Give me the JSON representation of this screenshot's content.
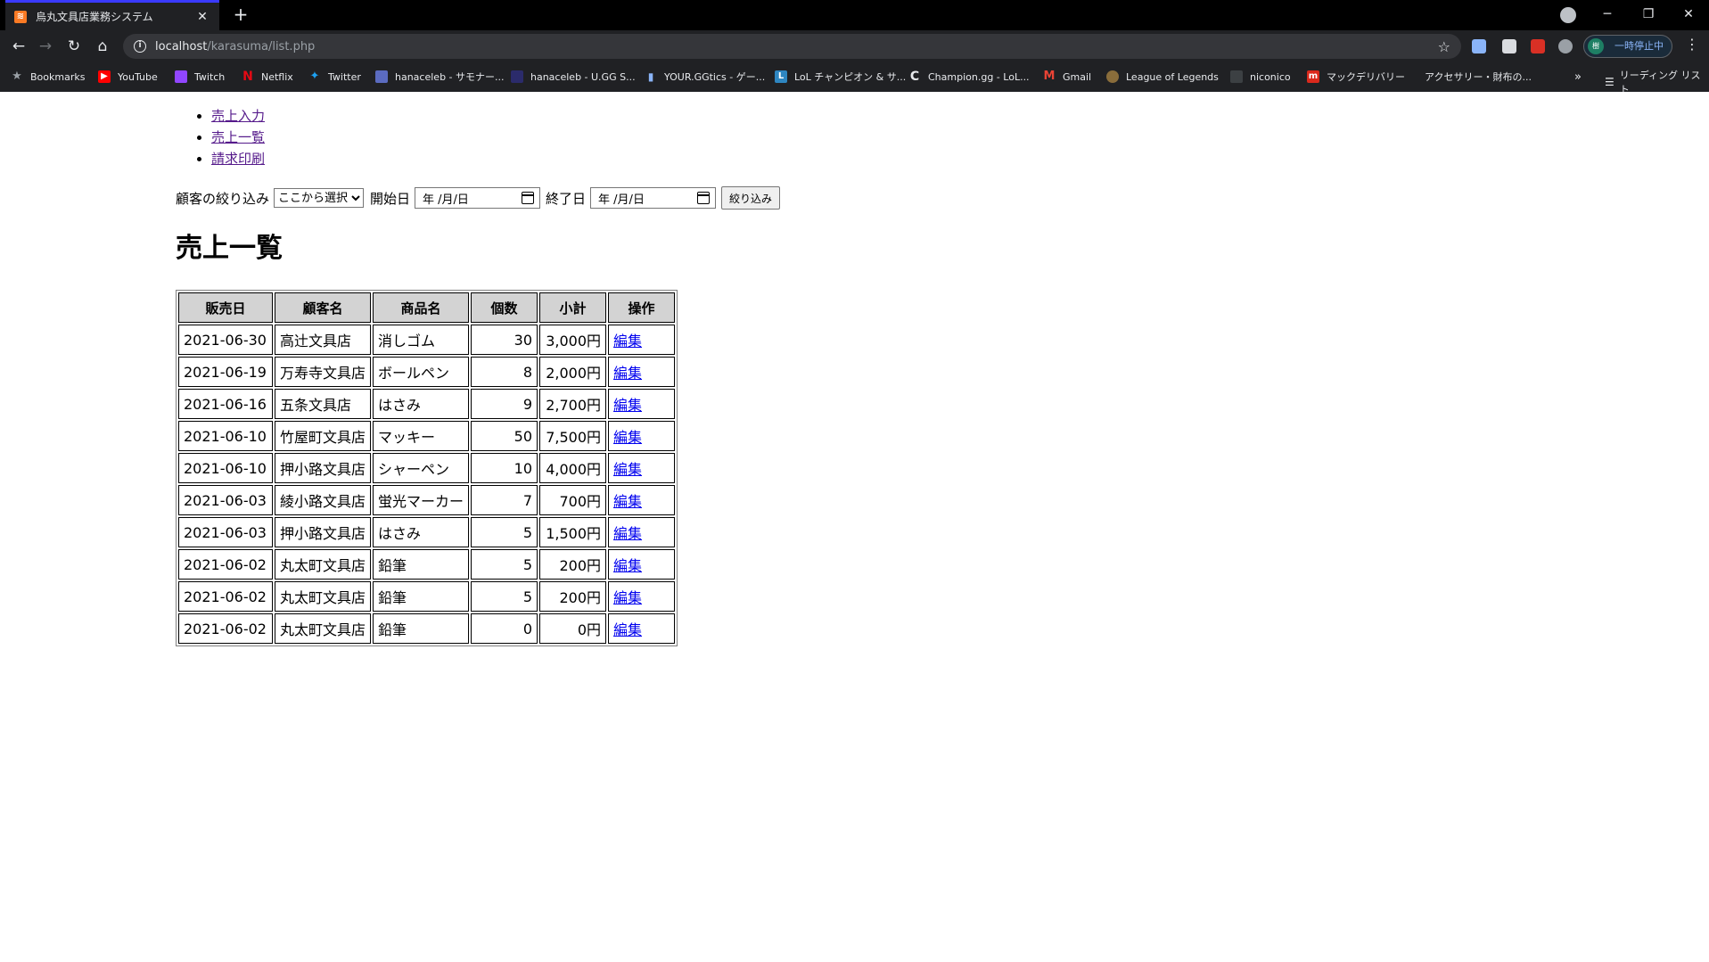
{
  "browser": {
    "tab_title": "烏丸文具店業務システム",
    "url_host": "localhost",
    "url_path": "/karasuma/list.php",
    "pause_label": "一時停止中",
    "reading_list": "リーディング リスト",
    "bookmarks": [
      {
        "label": "Bookmarks",
        "icon": "star-icon"
      },
      {
        "label": "YouTube",
        "icon": "youtube-icon"
      },
      {
        "label": "Twitch",
        "icon": "twitch-icon"
      },
      {
        "label": "Netflix",
        "icon": "netflix-icon"
      },
      {
        "label": "Twitter",
        "icon": "twitter-icon"
      },
      {
        "label": "hanaceleb - サモナー...",
        "icon": "site-icon"
      },
      {
        "label": "hanaceleb - U.GG S...",
        "icon": "ugg-icon"
      },
      {
        "label": "YOUR.GGtics - ゲー...",
        "icon": "chart-icon"
      },
      {
        "label": "LoL チャンピオン & サ...",
        "icon": "lol-icon"
      },
      {
        "label": "Champion.gg - LoL...",
        "icon": "champion-icon"
      },
      {
        "label": "Gmail",
        "icon": "gmail-icon"
      },
      {
        "label": "League of Legends",
        "icon": "league-icon"
      },
      {
        "label": "niconico",
        "icon": "niconico-icon"
      },
      {
        "label": "マックデリバリー",
        "icon": "mcdonalds-icon"
      },
      {
        "label": "アクセサリー・財布の...",
        "icon": "none"
      }
    ]
  },
  "nav": {
    "items": [
      "売上入力",
      "売上一覧",
      "請求印刷"
    ]
  },
  "filter": {
    "customer_label": "顧客の絞り込み",
    "customer_selected": "ここから選択",
    "start_label": "開始日",
    "start_value": "年 /月/日",
    "end_label": "終了日",
    "end_value": "年 /月/日",
    "button_label": "絞り込み"
  },
  "page_title": "売上一覧",
  "table": {
    "headers": [
      "販売日",
      "顧客名",
      "商品名",
      "個数",
      "小計",
      "操作"
    ],
    "rows": [
      {
        "date": "2021-06-30",
        "customer": "高辻文具店",
        "product": "消しゴム",
        "qty": "30",
        "subtotal": "3,000円",
        "action": "編集"
      },
      {
        "date": "2021-06-19",
        "customer": "万寿寺文具店",
        "product": "ボールペン",
        "qty": "8",
        "subtotal": "2,000円",
        "action": "編集"
      },
      {
        "date": "2021-06-16",
        "customer": "五条文具店",
        "product": "はさみ",
        "qty": "9",
        "subtotal": "2,700円",
        "action": "編集"
      },
      {
        "date": "2021-06-10",
        "customer": "竹屋町文具店",
        "product": "マッキー",
        "qty": "50",
        "subtotal": "7,500円",
        "action": "編集"
      },
      {
        "date": "2021-06-10",
        "customer": "押小路文具店",
        "product": "シャーペン",
        "qty": "10",
        "subtotal": "4,000円",
        "action": "編集"
      },
      {
        "date": "2021-06-03",
        "customer": "綾小路文具店",
        "product": "蛍光マーカー",
        "qty": "7",
        "subtotal": "700円",
        "action": "編集"
      },
      {
        "date": "2021-06-03",
        "customer": "押小路文具店",
        "product": "はさみ",
        "qty": "5",
        "subtotal": "1,500円",
        "action": "編集"
      },
      {
        "date": "2021-06-02",
        "customer": "丸太町文具店",
        "product": "鉛筆",
        "qty": "5",
        "subtotal": "200円",
        "action": "編集"
      },
      {
        "date": "2021-06-02",
        "customer": "丸太町文具店",
        "product": "鉛筆",
        "qty": "5",
        "subtotal": "200円",
        "action": "編集"
      },
      {
        "date": "2021-06-02",
        "customer": "丸太町文具店",
        "product": "鉛筆",
        "qty": "0",
        "subtotal": "0円",
        "action": "編集"
      }
    ]
  }
}
